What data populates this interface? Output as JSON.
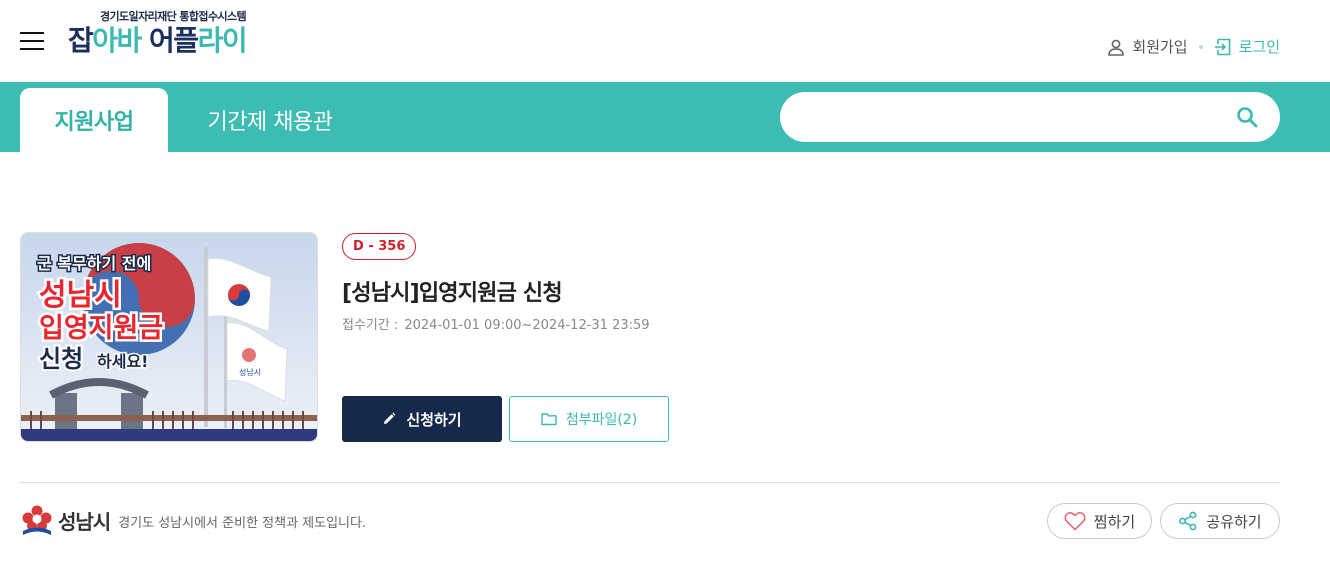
{
  "header": {
    "logo_sub": "경기도일자리재단 통합접수시스템",
    "logo_part1": "잡",
    "logo_part2": "아바 ",
    "logo_part3": "어플",
    "logo_part4": "라이",
    "signup_label": "회원가입",
    "login_label": "로그인"
  },
  "tabs": [
    {
      "label": "지원사업",
      "active": true
    },
    {
      "label": "기간제 채용관",
      "active": false
    }
  ],
  "search": {
    "placeholder": "",
    "value": ""
  },
  "program": {
    "dday": "D - 356",
    "title": "[성남시]입영지원금 신청",
    "period_label": "접수기간 :",
    "period_value": "2024-01-01 09:00~2024-12-31 23:59",
    "apply_label": "신청하기",
    "attach_label": "첨부파일(2)",
    "thumbnail": {
      "line1": "군 복무하기 전에",
      "line2": "성남시",
      "line3": "입영지원금",
      "line4a": "신청",
      "line4b": "하세요!",
      "flag_text": "성남시"
    }
  },
  "footer": {
    "org_name": "성남시",
    "org_desc": "경기도 성남시에서 준비한 정책과 제도입니다.",
    "like_label": "찜하기",
    "share_label": "공유하기"
  },
  "colors": {
    "teal": "#3cbcb3",
    "navy": "#16294a",
    "dday_red": "#d0202a"
  }
}
